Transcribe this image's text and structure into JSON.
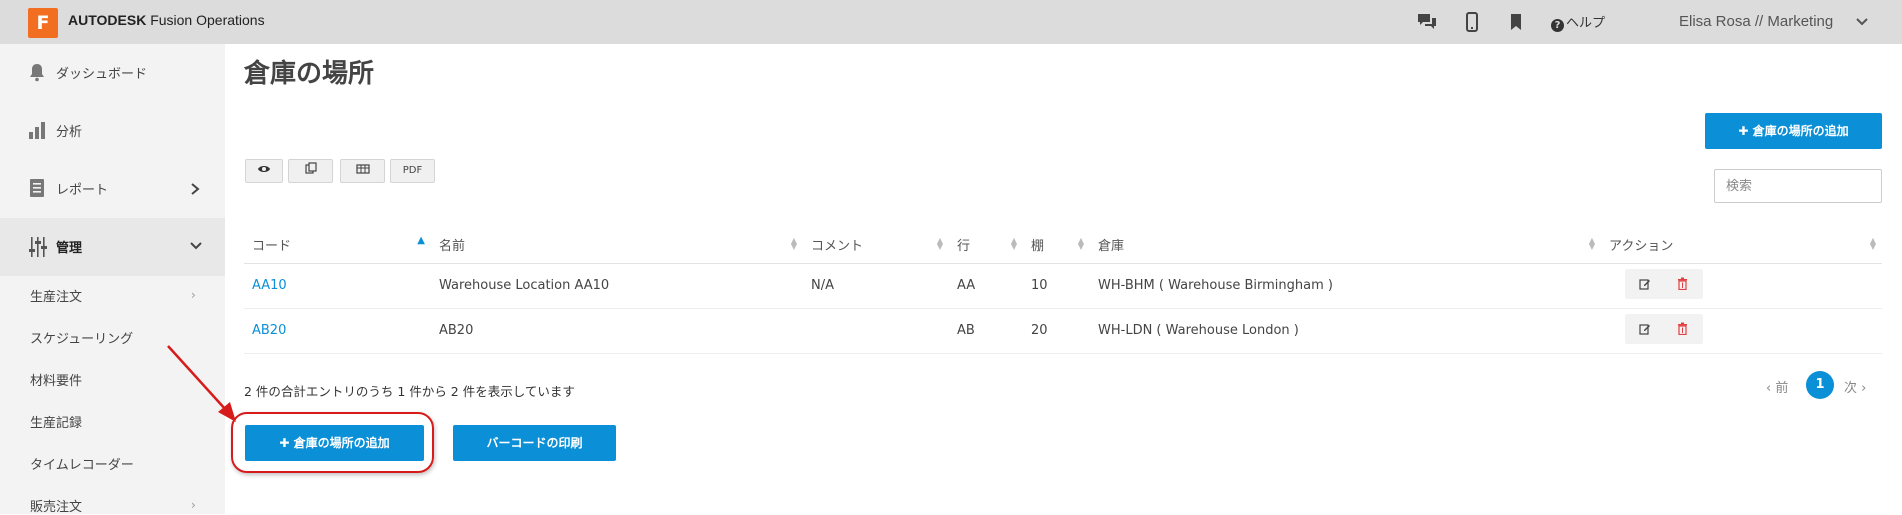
{
  "header": {
    "logo_letter": "F",
    "brand_bold": "AUTODESK",
    "brand_rest": " Fusion Operations",
    "help_label": "ヘルプ",
    "user_label": "Elisa Rosa // Marketing",
    "icons": [
      "chat-icon",
      "mobile-icon",
      "bookmark-icon",
      "help-icon",
      "chevron-down-icon"
    ]
  },
  "sidebar": {
    "items": [
      {
        "label": "ダッシュボード",
        "icon": "bell-icon"
      },
      {
        "label": "分析",
        "icon": "bar-chart-icon"
      },
      {
        "label": "レポート",
        "icon": "report-icon"
      },
      {
        "label": "管理",
        "icon": "sliders-icon"
      }
    ],
    "subitems": [
      "生産注文",
      "スケジューリング",
      "材料要件",
      "生産記録",
      "タイムレコーダー",
      "販売注文"
    ]
  },
  "page": {
    "title": "倉庫の場所",
    "add_button": "倉庫の場所の追加",
    "toolbar": {
      "pdf": "PDF"
    },
    "search_placeholder": "検索"
  },
  "table": {
    "columns": [
      "コード",
      "名前",
      "コメント",
      "行",
      "棚",
      "倉庫",
      "アクション"
    ],
    "rows": [
      {
        "code": "AA10",
        "name": "Warehouse Location AA10",
        "comment": "N/A",
        "row": "AA",
        "shelf": "10",
        "warehouse": "WH-BHM ( Warehouse Birmingham )"
      },
      {
        "code": "AB20",
        "name": "AB20",
        "comment": "",
        "row": "AB",
        "shelf": "20",
        "warehouse": "WH-LDN ( Warehouse London )"
      }
    ]
  },
  "footer": {
    "info": "2 件の合計エントリのうち 1 件から 2 件を表示しています",
    "prev": "前",
    "current_page": "1",
    "next": "次",
    "add_button": "倉庫の場所の追加",
    "barcode_button": "バーコードの印刷"
  },
  "colors": {
    "accent": "#0b8fd6",
    "logo": "#f26e21",
    "annotation": "#d71a1a"
  }
}
